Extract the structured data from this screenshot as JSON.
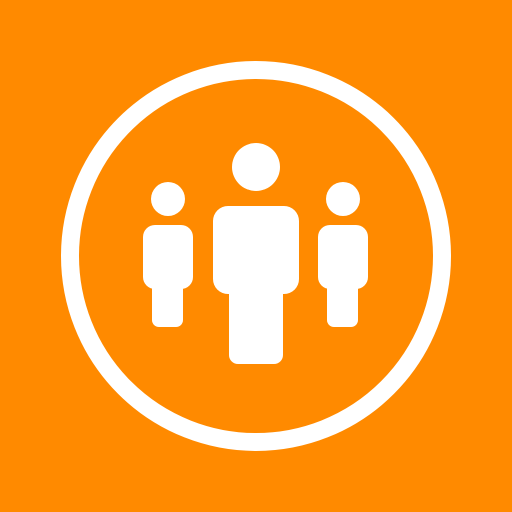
{
  "icon": {
    "name": "group-people-icon",
    "background_color": "#ff8a00",
    "foreground_color": "#ffffff"
  }
}
